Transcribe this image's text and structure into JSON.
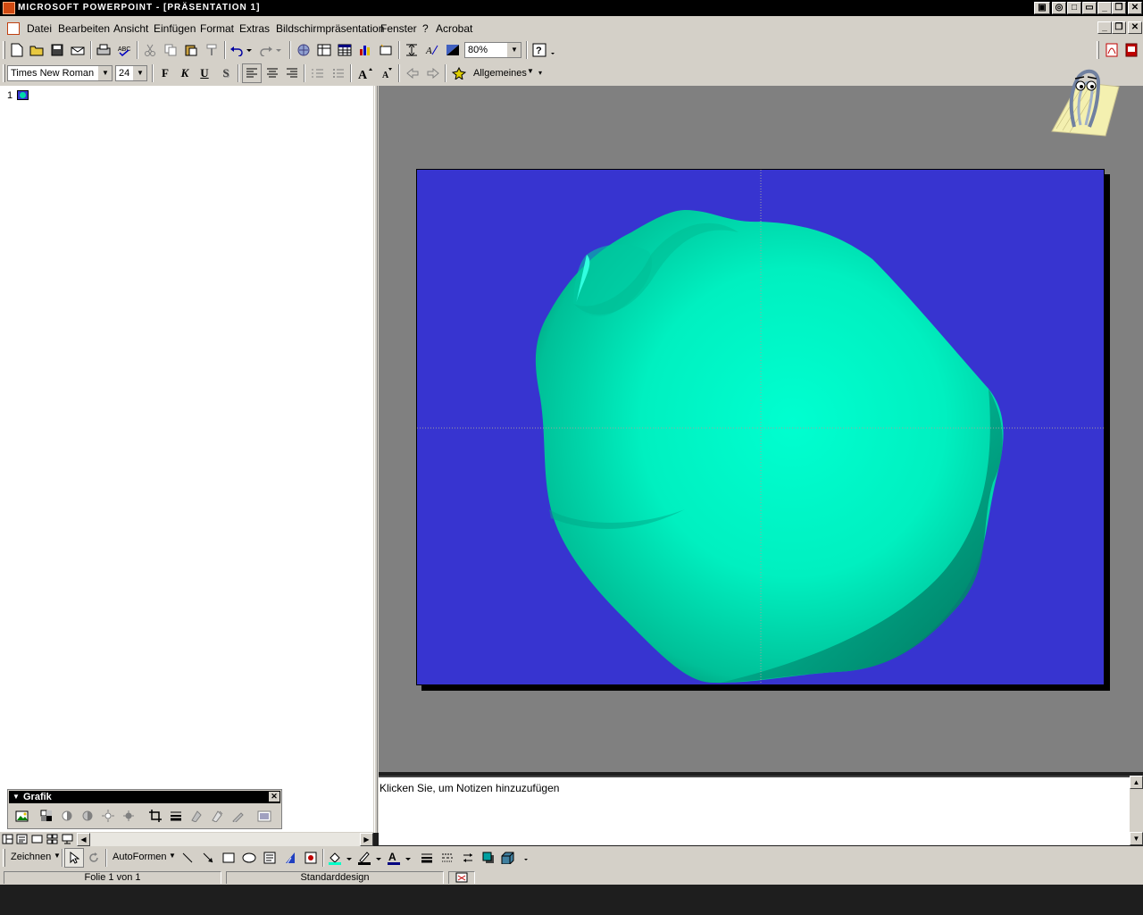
{
  "window": {
    "title": "MICROSOFT POWERPOINT - [PRÄSENTATION 1]"
  },
  "menubar": {
    "items": [
      "Datei",
      "Bearbeiten",
      "Ansicht",
      "Einfügen",
      "Format",
      "Extras",
      "Bildschirmpräsentation",
      "Fenster",
      "?",
      "Acrobat"
    ]
  },
  "toolbar": {
    "zoom": "80%",
    "font_name": "Times New Roman",
    "font_size": "24",
    "bold_label": "F",
    "italic_label": "K",
    "underline_label": "U",
    "shadow_label": "S",
    "common_tasks_label": "Allgemeines"
  },
  "outline": {
    "slide_number": "1"
  },
  "notes": {
    "placeholder": "Klicken Sie, um Notizen hinzuzufügen"
  },
  "grafik_toolbar": {
    "title": "Grafik"
  },
  "draw_toolbar": {
    "draw_label": "Zeichnen",
    "autoshapes_label": "AutoFormen"
  },
  "statusbar": {
    "slide_info": "Folie 1 von 1",
    "design": "Standarddesign"
  },
  "colors": {
    "slide_background": "#3734d0",
    "shape_fill": "#00ffc8",
    "chrome": "#d4d0c8",
    "work_area": "#808080"
  }
}
